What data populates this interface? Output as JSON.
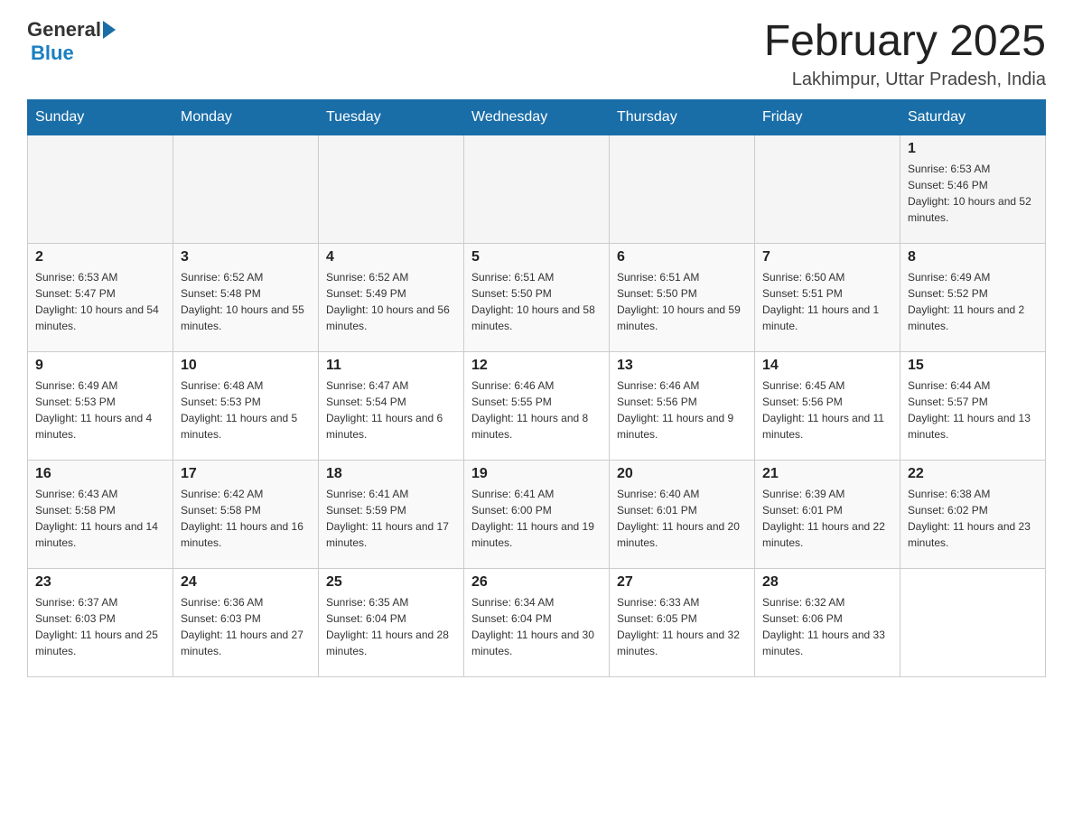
{
  "header": {
    "logo_general": "General",
    "logo_blue": "Blue",
    "month_title": "February 2025",
    "location": "Lakhimpur, Uttar Pradesh, India"
  },
  "days_of_week": [
    "Sunday",
    "Monday",
    "Tuesday",
    "Wednesday",
    "Thursday",
    "Friday",
    "Saturday"
  ],
  "weeks": [
    [
      {
        "day": "",
        "info": ""
      },
      {
        "day": "",
        "info": ""
      },
      {
        "day": "",
        "info": ""
      },
      {
        "day": "",
        "info": ""
      },
      {
        "day": "",
        "info": ""
      },
      {
        "day": "",
        "info": ""
      },
      {
        "day": "1",
        "info": "Sunrise: 6:53 AM\nSunset: 5:46 PM\nDaylight: 10 hours and 52 minutes."
      }
    ],
    [
      {
        "day": "2",
        "info": "Sunrise: 6:53 AM\nSunset: 5:47 PM\nDaylight: 10 hours and 54 minutes."
      },
      {
        "day": "3",
        "info": "Sunrise: 6:52 AM\nSunset: 5:48 PM\nDaylight: 10 hours and 55 minutes."
      },
      {
        "day": "4",
        "info": "Sunrise: 6:52 AM\nSunset: 5:49 PM\nDaylight: 10 hours and 56 minutes."
      },
      {
        "day": "5",
        "info": "Sunrise: 6:51 AM\nSunset: 5:50 PM\nDaylight: 10 hours and 58 minutes."
      },
      {
        "day": "6",
        "info": "Sunrise: 6:51 AM\nSunset: 5:50 PM\nDaylight: 10 hours and 59 minutes."
      },
      {
        "day": "7",
        "info": "Sunrise: 6:50 AM\nSunset: 5:51 PM\nDaylight: 11 hours and 1 minute."
      },
      {
        "day": "8",
        "info": "Sunrise: 6:49 AM\nSunset: 5:52 PM\nDaylight: 11 hours and 2 minutes."
      }
    ],
    [
      {
        "day": "9",
        "info": "Sunrise: 6:49 AM\nSunset: 5:53 PM\nDaylight: 11 hours and 4 minutes."
      },
      {
        "day": "10",
        "info": "Sunrise: 6:48 AM\nSunset: 5:53 PM\nDaylight: 11 hours and 5 minutes."
      },
      {
        "day": "11",
        "info": "Sunrise: 6:47 AM\nSunset: 5:54 PM\nDaylight: 11 hours and 6 minutes."
      },
      {
        "day": "12",
        "info": "Sunrise: 6:46 AM\nSunset: 5:55 PM\nDaylight: 11 hours and 8 minutes."
      },
      {
        "day": "13",
        "info": "Sunrise: 6:46 AM\nSunset: 5:56 PM\nDaylight: 11 hours and 9 minutes."
      },
      {
        "day": "14",
        "info": "Sunrise: 6:45 AM\nSunset: 5:56 PM\nDaylight: 11 hours and 11 minutes."
      },
      {
        "day": "15",
        "info": "Sunrise: 6:44 AM\nSunset: 5:57 PM\nDaylight: 11 hours and 13 minutes."
      }
    ],
    [
      {
        "day": "16",
        "info": "Sunrise: 6:43 AM\nSunset: 5:58 PM\nDaylight: 11 hours and 14 minutes."
      },
      {
        "day": "17",
        "info": "Sunrise: 6:42 AM\nSunset: 5:58 PM\nDaylight: 11 hours and 16 minutes."
      },
      {
        "day": "18",
        "info": "Sunrise: 6:41 AM\nSunset: 5:59 PM\nDaylight: 11 hours and 17 minutes."
      },
      {
        "day": "19",
        "info": "Sunrise: 6:41 AM\nSunset: 6:00 PM\nDaylight: 11 hours and 19 minutes."
      },
      {
        "day": "20",
        "info": "Sunrise: 6:40 AM\nSunset: 6:01 PM\nDaylight: 11 hours and 20 minutes."
      },
      {
        "day": "21",
        "info": "Sunrise: 6:39 AM\nSunset: 6:01 PM\nDaylight: 11 hours and 22 minutes."
      },
      {
        "day": "22",
        "info": "Sunrise: 6:38 AM\nSunset: 6:02 PM\nDaylight: 11 hours and 23 minutes."
      }
    ],
    [
      {
        "day": "23",
        "info": "Sunrise: 6:37 AM\nSunset: 6:03 PM\nDaylight: 11 hours and 25 minutes."
      },
      {
        "day": "24",
        "info": "Sunrise: 6:36 AM\nSunset: 6:03 PM\nDaylight: 11 hours and 27 minutes."
      },
      {
        "day": "25",
        "info": "Sunrise: 6:35 AM\nSunset: 6:04 PM\nDaylight: 11 hours and 28 minutes."
      },
      {
        "day": "26",
        "info": "Sunrise: 6:34 AM\nSunset: 6:04 PM\nDaylight: 11 hours and 30 minutes."
      },
      {
        "day": "27",
        "info": "Sunrise: 6:33 AM\nSunset: 6:05 PM\nDaylight: 11 hours and 32 minutes."
      },
      {
        "day": "28",
        "info": "Sunrise: 6:32 AM\nSunset: 6:06 PM\nDaylight: 11 hours and 33 minutes."
      },
      {
        "day": "",
        "info": ""
      }
    ]
  ]
}
